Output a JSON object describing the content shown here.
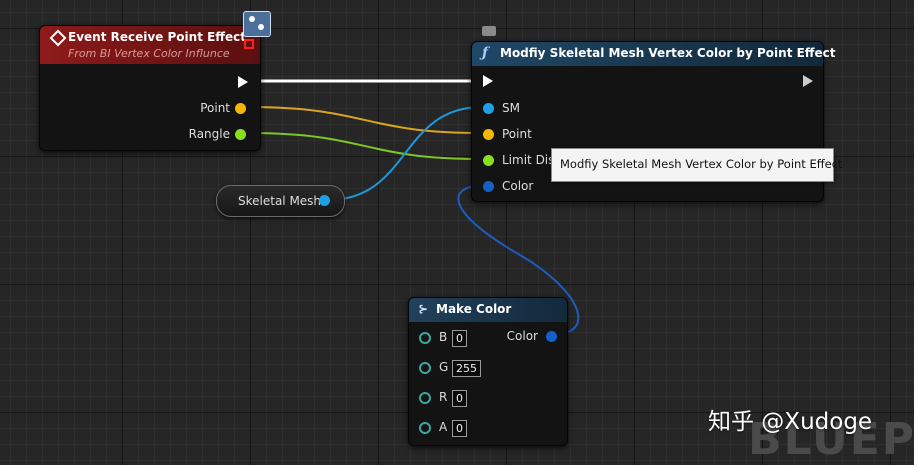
{
  "event_node": {
    "title": "Event Receive Point Effect",
    "subtitle": "From BI Vertex Color Influnce",
    "pins": [
      {
        "label": "Point",
        "color": "#f5b800"
      },
      {
        "label": "Rangle",
        "color": "#86e020"
      }
    ]
  },
  "function_node": {
    "title": "Modfiy Skeletal Mesh Vertex Color by Point Effect",
    "function_icon": "function-icon",
    "pins": [
      {
        "label": "SM",
        "color": "#1ea0e8"
      },
      {
        "label": "Point",
        "color": "#f5b800"
      },
      {
        "label": "Limit Dis",
        "color": "#86e020"
      },
      {
        "label": "Color",
        "color": "#1560c8"
      }
    ]
  },
  "tooltip": {
    "text": "Modfiy Skeletal Mesh Vertex Color by Point Effect"
  },
  "variable_node": {
    "label": "Skeletal Mesh",
    "color": "#1ea0e8"
  },
  "make_color_node": {
    "title": "Make Color",
    "output_label": "Color",
    "inputs": [
      {
        "label": "B",
        "value": "0"
      },
      {
        "label": "G",
        "value": "255"
      },
      {
        "label": "R",
        "value": "0"
      },
      {
        "label": "A",
        "value": "0"
      }
    ]
  },
  "watermark": {
    "text": "知乎 @Xudoge",
    "background_text": "BLUEP"
  },
  "colors": {
    "exec": "#ffffff",
    "vector": "#f5b800",
    "float": "#86e020",
    "object": "#1ea0e8",
    "struct_color": "#1560c8",
    "event_header": "#8a1818",
    "function_header": "#1d3e58"
  }
}
